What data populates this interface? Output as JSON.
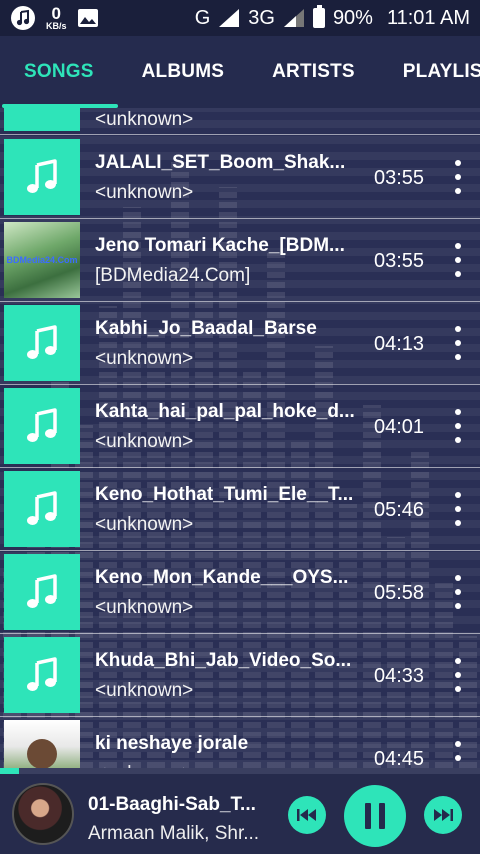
{
  "status": {
    "net_speed": "0",
    "net_unit": "KB/s",
    "network_letter": "G",
    "network_type": "3G",
    "battery": "90%",
    "time": "11:01 AM"
  },
  "tabs": [
    "SONGS",
    "ALBUMS",
    "ARTISTS",
    "PLAYLIS"
  ],
  "partial_row_text": "<unknown>",
  "songs": [
    {
      "title": "JALALI_SET_Boom_Shak...",
      "artist": "<unknown>",
      "duration": "03:55",
      "thumb": "music-note"
    },
    {
      "title": "Jeno Tomari Kache_[BDM...",
      "artist": "[BDMedia24.Com]",
      "duration": "03:55",
      "thumb": "photo-green",
      "watermark": "BDMedia24.Com"
    },
    {
      "title": "Kabhi_Jo_Baadal_Barse",
      "artist": "<unknown>",
      "duration": "04:13",
      "thumb": "music-note"
    },
    {
      "title": "Kahta_hai_pal_pal_hoke_d...",
      "artist": "<unknown>",
      "duration": "04:01",
      "thumb": "music-note"
    },
    {
      "title": "Keno_Hothat_Tumi_Ele__T...",
      "artist": "<unknown>",
      "duration": "05:46",
      "thumb": "music-note"
    },
    {
      "title": "Keno_Mon_Kande___OYS...",
      "artist": "<unknown>",
      "duration": "05:58",
      "thumb": "music-note"
    },
    {
      "title": "Khuda_Bhi_Jab_Video_So...",
      "artist": "<unknown>",
      "duration": "04:33",
      "thumb": "music-note"
    },
    {
      "title": "ki neshaye jorale",
      "artist": "<unknown>",
      "duration": "04:45",
      "thumb": "photo-person"
    }
  ],
  "now_playing": {
    "title": "01-Baaghi-Sab_T...",
    "artist": "Armaan Malik, Shr...",
    "progress": 0.04
  },
  "colors": {
    "accent": "#2ee4b9",
    "background": "#242a4c"
  }
}
